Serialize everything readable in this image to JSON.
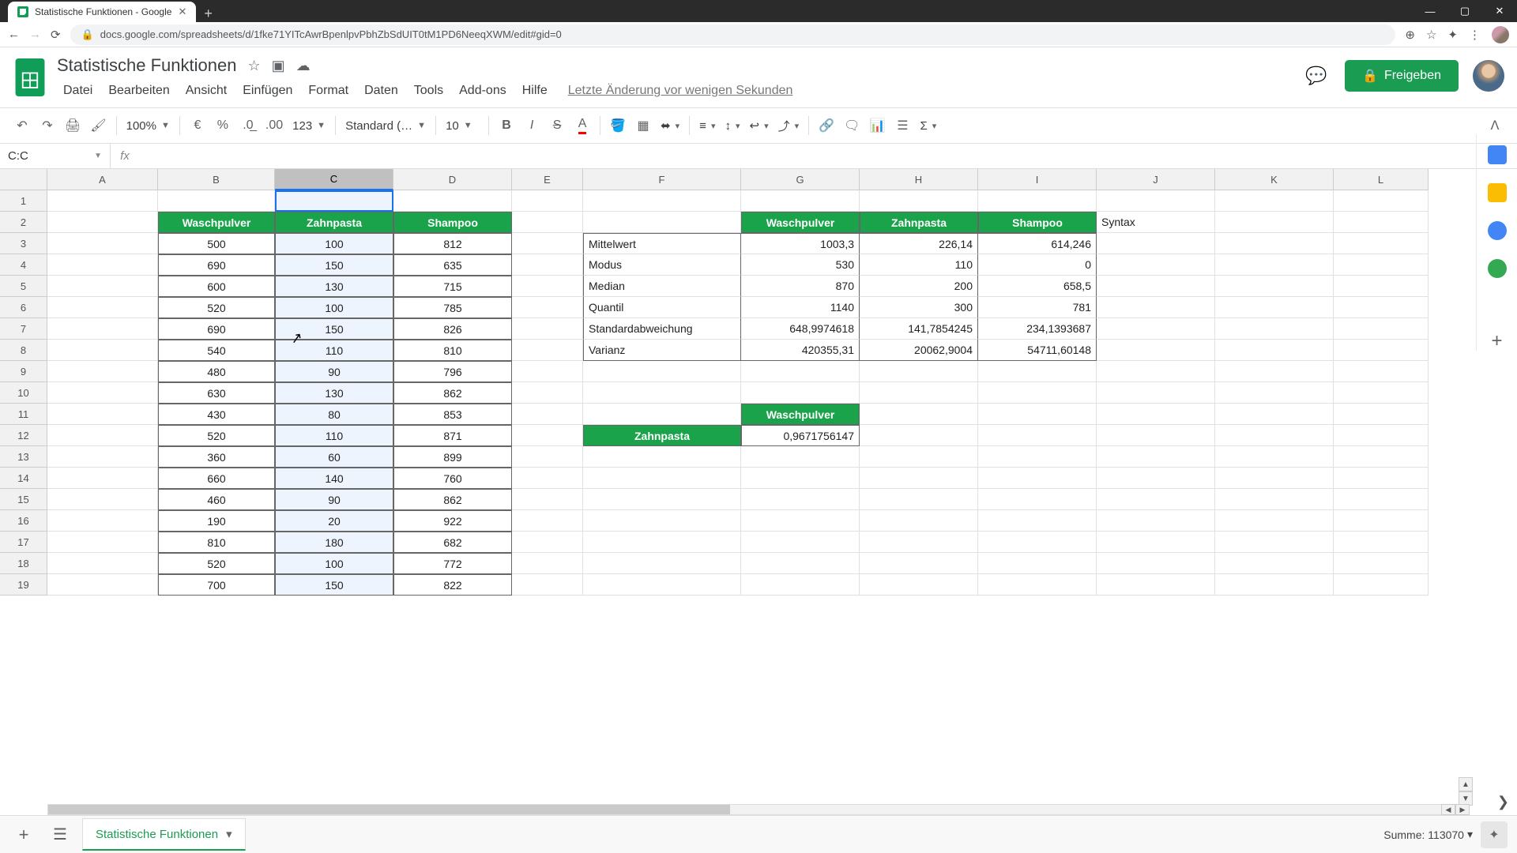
{
  "browser": {
    "tab_title": "Statistische Funktionen - Google",
    "url": "docs.google.com/spreadsheets/d/1fke71YITcAwrBpenlpvPbhZbSdUIT0tM1PD6NeeqXWM/edit#gid=0"
  },
  "doc": {
    "title": "Statistische Funktionen",
    "last_edit": "Letzte Änderung vor wenigen Sekunden"
  },
  "menu": [
    "Datei",
    "Bearbeiten",
    "Ansicht",
    "Einfügen",
    "Format",
    "Daten",
    "Tools",
    "Add-ons",
    "Hilfe"
  ],
  "share_label": "Freigeben",
  "toolbar": {
    "zoom": "100%",
    "font": "Standard (…",
    "font_size": "10"
  },
  "name_box": "C:C",
  "columns": [
    "A",
    "B",
    "C",
    "D",
    "E",
    "F",
    "G",
    "H",
    "I",
    "J",
    "K",
    "L"
  ],
  "rows": [
    "1",
    "2",
    "3",
    "4",
    "5",
    "6",
    "7",
    "8",
    "9",
    "10",
    "11",
    "12",
    "13",
    "14",
    "15",
    "16",
    "17",
    "18",
    "19"
  ],
  "table1": {
    "headers": [
      "Waschpulver",
      "Zahnpasta",
      "Shampoo"
    ],
    "rows": [
      [
        "500",
        "100",
        "812"
      ],
      [
        "690",
        "150",
        "635"
      ],
      [
        "600",
        "130",
        "715"
      ],
      [
        "520",
        "100",
        "785"
      ],
      [
        "690",
        "150",
        "826"
      ],
      [
        "540",
        "110",
        "810"
      ],
      [
        "480",
        "90",
        "796"
      ],
      [
        "630",
        "130",
        "862"
      ],
      [
        "430",
        "80",
        "853"
      ],
      [
        "520",
        "110",
        "871"
      ],
      [
        "360",
        "60",
        "899"
      ],
      [
        "660",
        "140",
        "760"
      ],
      [
        "460",
        "90",
        "862"
      ],
      [
        "190",
        "20",
        "922"
      ],
      [
        "810",
        "180",
        "682"
      ],
      [
        "520",
        "100",
        "772"
      ],
      [
        "700",
        "150",
        "822"
      ]
    ]
  },
  "stats": {
    "labels": [
      "Mittelwert",
      "Modus",
      "Median",
      "Quantil",
      "Standardabweichung",
      "Varianz"
    ],
    "headers": [
      "Waschpulver",
      "Zahnpasta",
      "Shampoo"
    ],
    "syntax_label": "Syntax",
    "values": [
      [
        "1003,3",
        "226,14",
        "614,246"
      ],
      [
        "530",
        "110",
        "0"
      ],
      [
        "870",
        "200",
        "658,5"
      ],
      [
        "1140",
        "300",
        "781"
      ],
      [
        "648,9974618",
        "141,7854245",
        "234,1393687"
      ],
      [
        "420355,31",
        "20062,9004",
        "54711,60148"
      ]
    ]
  },
  "corr": {
    "col_header": "Waschpulver",
    "row_header": "Zahnpasta",
    "value": "0,9671756147"
  },
  "footer": {
    "sheet_name": "Statistische Funktionen",
    "sum": "Summe: 113070"
  }
}
